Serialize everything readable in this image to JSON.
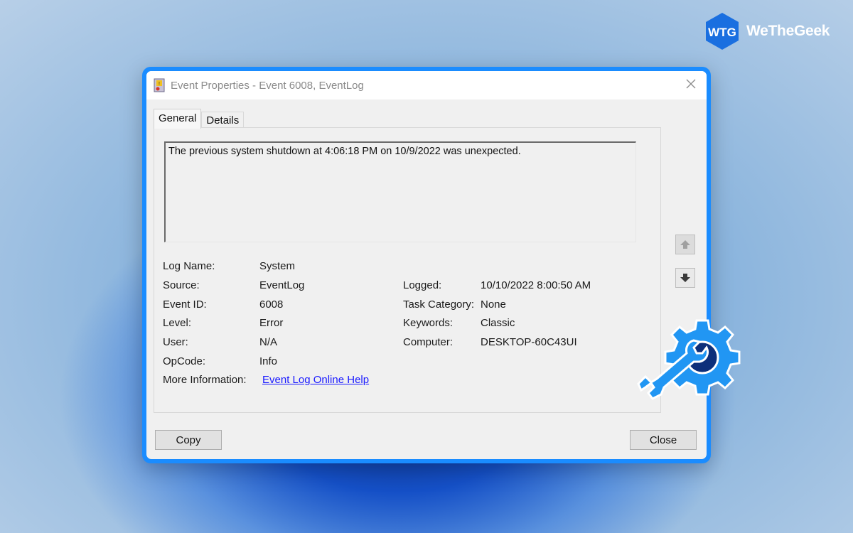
{
  "brand": {
    "logo_text": "WTG",
    "name": "WeTheGeek",
    "color": "#1a6fe0"
  },
  "window": {
    "title": "Event Properties - Event 6008, EventLog",
    "icon": "event-log-icon",
    "close_icon": "close-icon",
    "accent_border": "#1a8cff"
  },
  "tabs": [
    {
      "label": "General",
      "active": true
    },
    {
      "label": "Details",
      "active": false
    }
  ],
  "description": "The previous system shutdown at 4:06:18 PM on 10/9/2022 was unexpected.",
  "fields_left": [
    {
      "label": "Log Name:",
      "value": "System"
    },
    {
      "label": "Source:",
      "value": "EventLog"
    },
    {
      "label": "Event ID:",
      "value": "6008"
    },
    {
      "label": "Level:",
      "value": "Error"
    },
    {
      "label": "User:",
      "value": "N/A"
    },
    {
      "label": "OpCode:",
      "value": "Info"
    },
    {
      "label": "More Information:",
      "value": "Event Log Online Help"
    }
  ],
  "fields_right": [
    {
      "label": "Logged:",
      "value": "10/10/2022 8:00:50 AM"
    },
    {
      "label": "Task Category:",
      "value": "None"
    },
    {
      "label": "Keywords:",
      "value": "Classic"
    },
    {
      "label": "Computer:",
      "value": "DESKTOP-60C43UI"
    }
  ],
  "nav": {
    "up_icon": "arrow-up-icon",
    "down_icon": "arrow-down-icon",
    "up_enabled": false,
    "down_enabled": true
  },
  "buttons": {
    "copy": "Copy",
    "close": "Close"
  },
  "overlay_icon": "gear-wrench-icon"
}
